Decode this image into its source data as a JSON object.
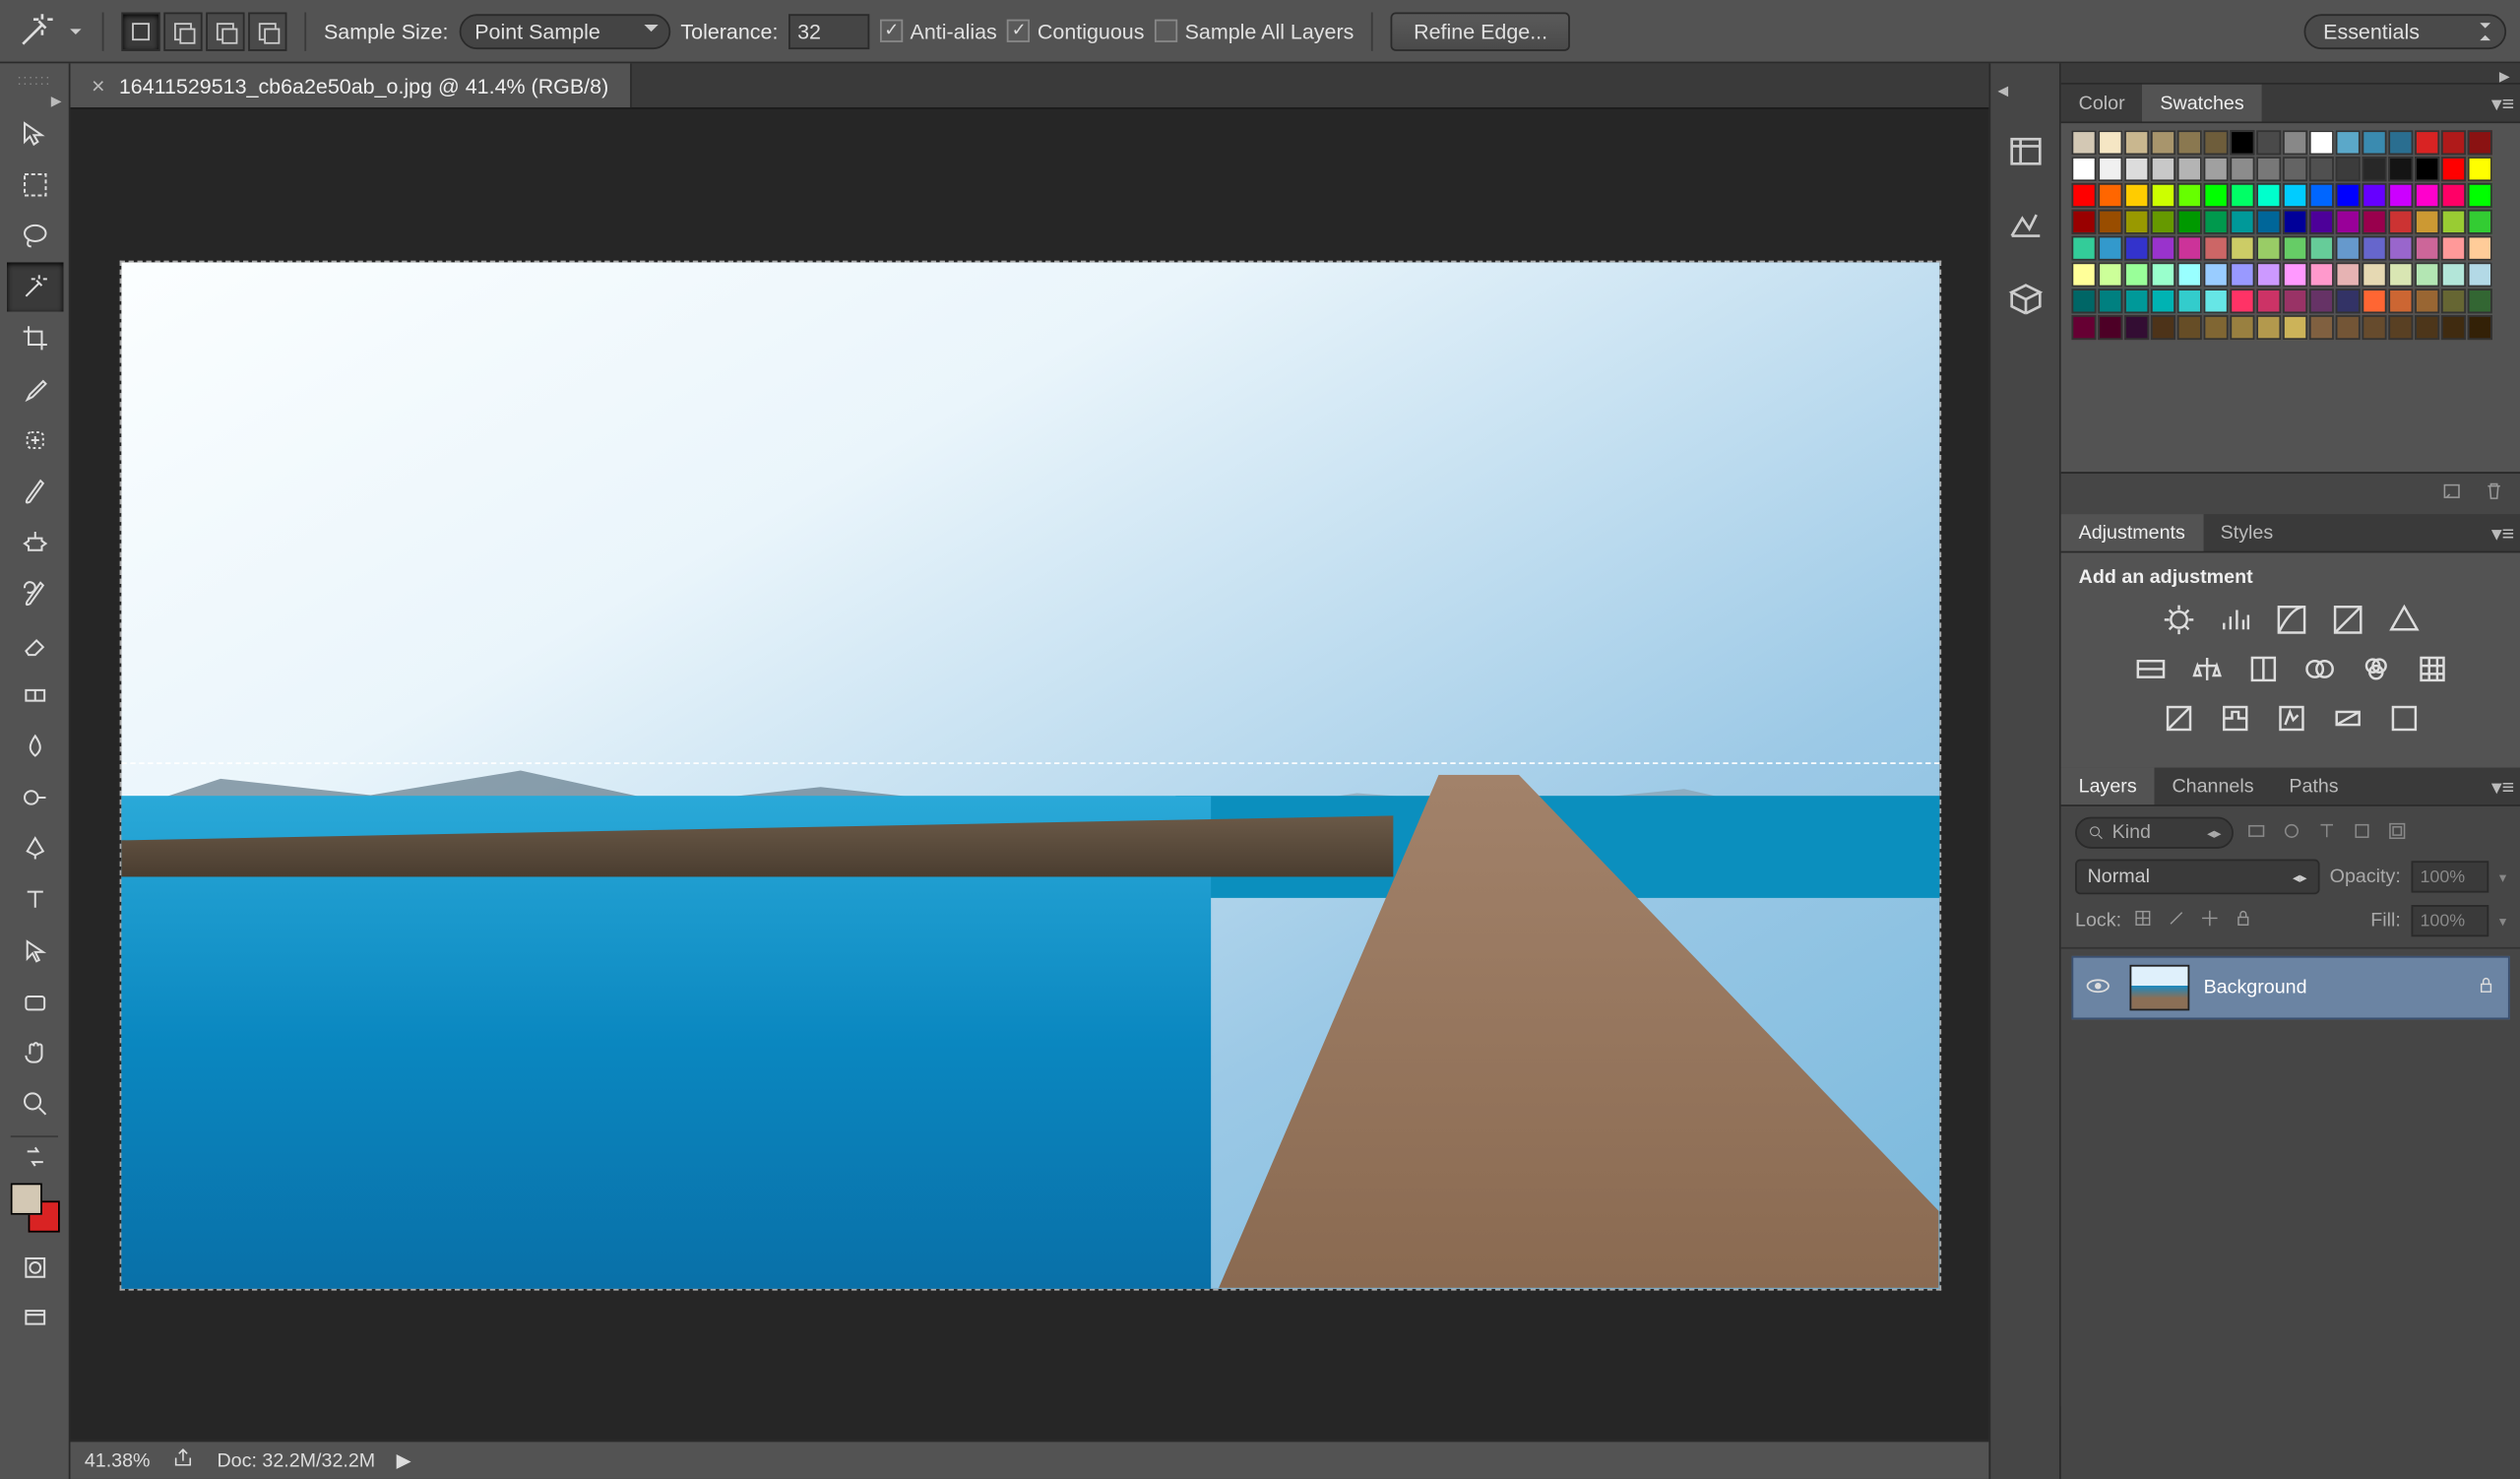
{
  "options_bar": {
    "sample_size_label": "Sample Size:",
    "sample_size_value": "Point Sample",
    "tolerance_label": "Tolerance:",
    "tolerance_value": "32",
    "anti_alias_label": "Anti-alias",
    "anti_alias_checked": true,
    "contiguous_label": "Contiguous",
    "contiguous_checked": true,
    "sample_all_label": "Sample All Layers",
    "sample_all_checked": false,
    "refine_edge_label": "Refine Edge...",
    "workspace": "Essentials"
  },
  "document": {
    "tab_title": "16411529513_cb6a2e50ab_o.jpg @ 41.4% (RGB/8)"
  },
  "status_bar": {
    "zoom": "41.38%",
    "doc_info": "Doc: 32.2M/32.2M"
  },
  "panels": {
    "color_tab": "Color",
    "swatches_tab": "Swatches",
    "adjustments_tab": "Adjustments",
    "styles_tab": "Styles",
    "add_adjustment": "Add an adjustment",
    "layers_tab": "Layers",
    "channels_tab": "Channels",
    "paths_tab": "Paths",
    "kind_label": "Kind",
    "blend_mode": "Normal",
    "opacity_label": "Opacity:",
    "opacity_value": "100%",
    "lock_label": "Lock:",
    "fill_label": "Fill:",
    "fill_value": "100%",
    "layer_name": "Background"
  },
  "swatches_colors": [
    "#d3c8b4",
    "#f5e6c4",
    "#c9b78f",
    "#a8956c",
    "#8a7850",
    "#6e5d3b",
    "#000000",
    "#4a4a4a",
    "#888888",
    "#ffffff",
    "#5ba8c9",
    "#3a8bb0",
    "#2a6e90",
    "#d92323",
    "#b01a1a",
    "#8a1212",
    "#ffffff",
    "#f0f0f0",
    "#dcdcdc",
    "#c8c8c8",
    "#b4b4b4",
    "#a0a0a0",
    "#8c8c8c",
    "#787878",
    "#646464",
    "#505050",
    "#3c3c3c",
    "#282828",
    "#141414",
    "#000000",
    "#ff0000",
    "#ffff00",
    "#ff0000",
    "#ff6600",
    "#ffcc00",
    "#ccff00",
    "#66ff00",
    "#00ff00",
    "#00ff66",
    "#00ffcc",
    "#00ccff",
    "#0066ff",
    "#0000ff",
    "#6600ff",
    "#cc00ff",
    "#ff00cc",
    "#ff0066",
    "#00ff00",
    "#990000",
    "#994d00",
    "#999900",
    "#669900",
    "#009900",
    "#00994d",
    "#009999",
    "#006699",
    "#000099",
    "#4d0099",
    "#990099",
    "#99004d",
    "#cc3333",
    "#cc9933",
    "#99cc33",
    "#33cc33",
    "#33cc99",
    "#3399cc",
    "#3333cc",
    "#9933cc",
    "#cc3399",
    "#cc6666",
    "#cccc66",
    "#99cc66",
    "#66cc66",
    "#66cc99",
    "#6699cc",
    "#6666cc",
    "#9966cc",
    "#cc6699",
    "#ff9999",
    "#ffcc99",
    "#ffff99",
    "#ccff99",
    "#99ff99",
    "#99ffcc",
    "#99ffff",
    "#99ccff",
    "#9999ff",
    "#cc99ff",
    "#ff99ff",
    "#ff99cc",
    "#e6b3b3",
    "#e6d9b3",
    "#d9e6b3",
    "#b3e6b3",
    "#b3e6d9",
    "#b3d9e6",
    "#006666",
    "#008080",
    "#009999",
    "#00b3b3",
    "#33cccc",
    "#66e6e6",
    "#ff3366",
    "#cc3366",
    "#993366",
    "#663366",
    "#333366",
    "#ff6633",
    "#cc6633",
    "#996633",
    "#666633",
    "#336633",
    "#660033",
    "#4d0026",
    "#330d33",
    "#4d3319",
    "#664d26",
    "#806633",
    "#998040",
    "#b3994d",
    "#ccb359",
    "#806040",
    "#735536",
    "#664b2d",
    "#594023",
    "#4d361a",
    "#402b10",
    "#332107"
  ]
}
